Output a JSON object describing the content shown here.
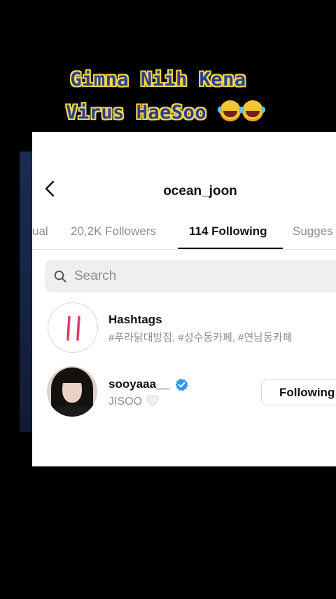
{
  "overlay": {
    "caption_line1": "Gimna Niih Kena",
    "caption_line2": "Virus HaeSoo"
  },
  "header": {
    "username": "ocean_joon"
  },
  "tabs": [
    {
      "label": "ual",
      "active": false
    },
    {
      "label": "20,2K Followers",
      "active": false
    },
    {
      "label": "114 Following",
      "active": true
    },
    {
      "label": "Sugges",
      "active": false
    }
  ],
  "search": {
    "placeholder": "Search"
  },
  "rows": [
    {
      "title": "Hashtags",
      "subtitle": "#푸라닭대방점, #성수동카페, #연남동카페",
      "icon": "hashtag-icon"
    },
    {
      "title": "sooyaaa__",
      "subtitle": "JISOO",
      "verified": true,
      "button_label": "Following"
    }
  ],
  "colors": {
    "caption_text": "#2b3f8f",
    "caption_outline": "#f3d64a",
    "verified_blue": "#3897f0",
    "muted_text": "#8e8e8e"
  }
}
